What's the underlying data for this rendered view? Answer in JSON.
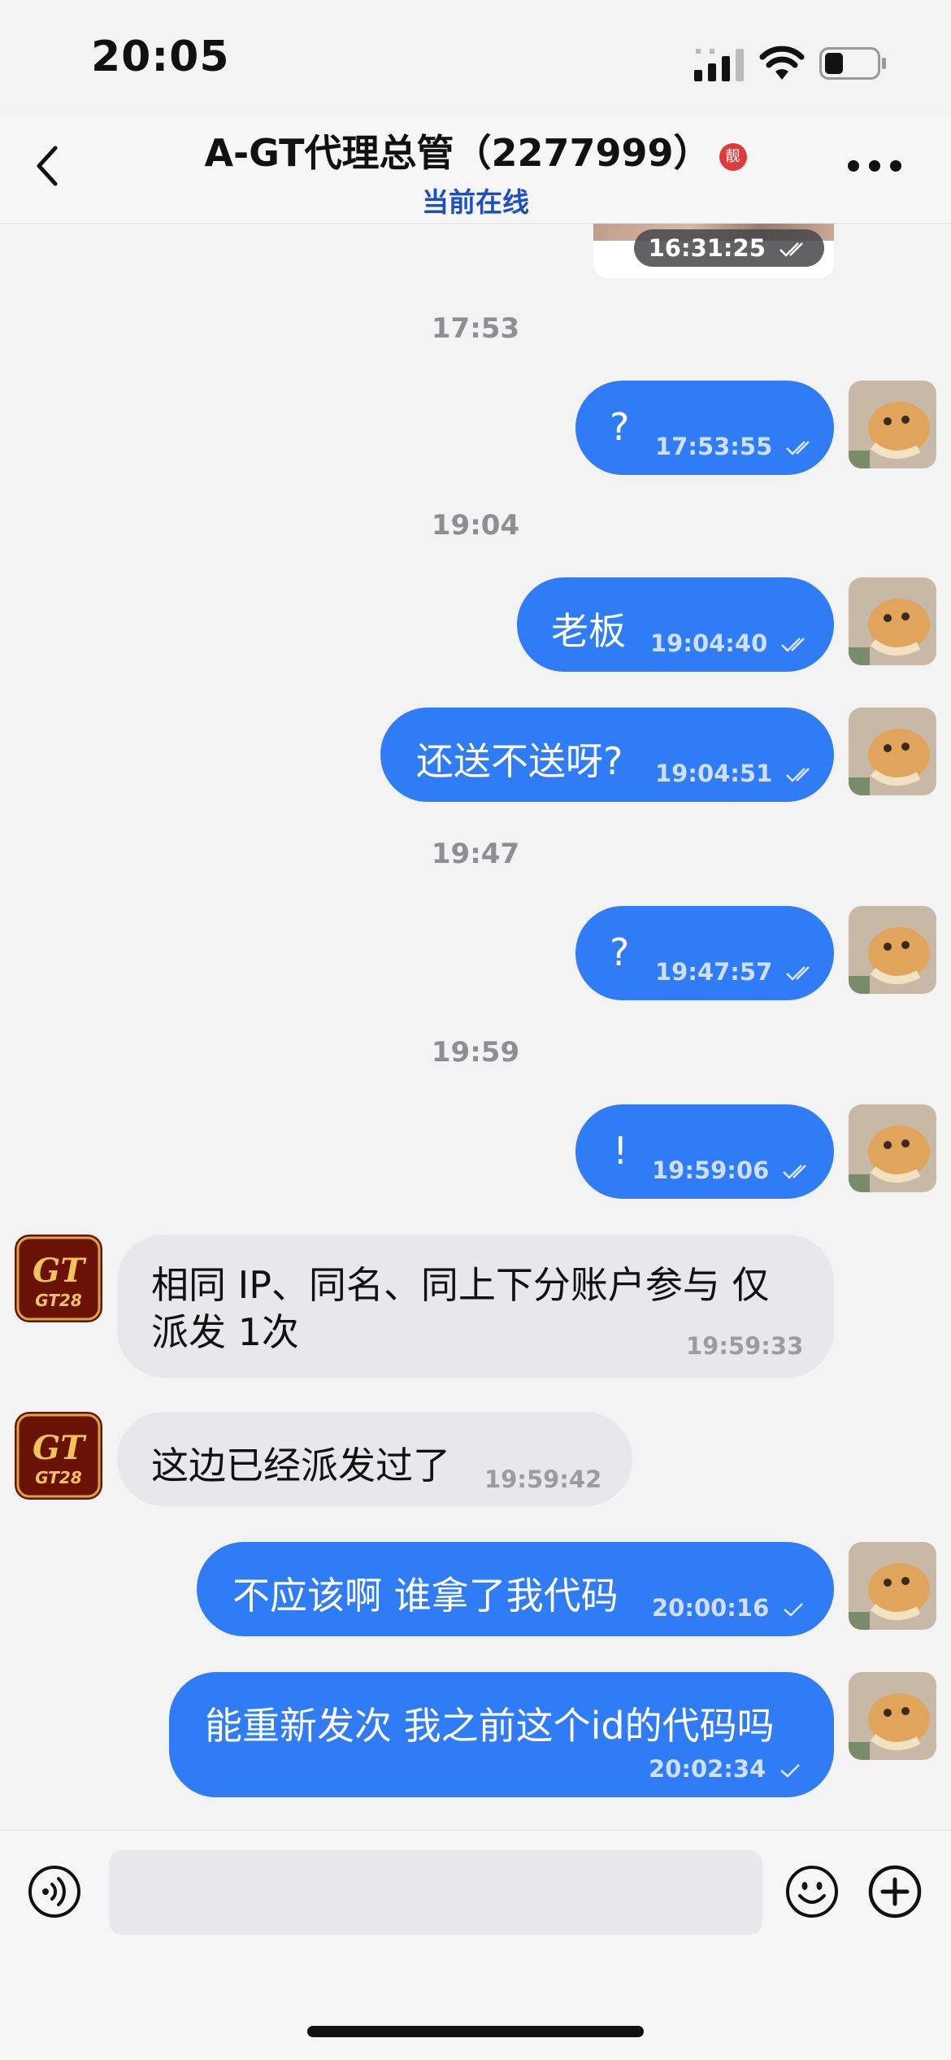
{
  "status_bar": {
    "time": "20:05"
  },
  "header": {
    "title": "A-GT代理总管（2277999）",
    "badge": "靓",
    "subtitle": "当前在线"
  },
  "chat": {
    "partial_image": {
      "time": "16:31:25"
    },
    "dividers": [
      "17:53",
      "19:04",
      "19:47",
      "19:59"
    ],
    "messages": [
      {
        "direction": "out",
        "text": "?",
        "time": "17:53:55",
        "status": "read"
      },
      {
        "direction": "out",
        "text": "老板",
        "time": "19:04:40",
        "status": "read"
      },
      {
        "direction": "out",
        "text": "还送不送呀?",
        "time": "19:04:51",
        "status": "read"
      },
      {
        "direction": "out",
        "text": "?",
        "time": "19:47:57",
        "status": "read"
      },
      {
        "direction": "out",
        "text": "!",
        "time": "19:59:06",
        "status": "read"
      },
      {
        "direction": "in",
        "text_line1": "相同 IP、同名、同上下分账户参与  仅",
        "text_line2": "派发 1次",
        "time": "19:59:33"
      },
      {
        "direction": "in",
        "text": "这边已经派发过了",
        "time": "19:59:42"
      },
      {
        "direction": "out",
        "text": "不应该啊 谁拿了我代码",
        "time": "20:00:16",
        "status": "sent"
      },
      {
        "direction": "out",
        "text": "能重新发次 我之前这个id的代码吗",
        "time": "20:02:34",
        "status": "sent"
      }
    ]
  },
  "avatars": {
    "self": "cat-photo",
    "contact_logo_text": "GT28",
    "contact_logo_mark": "GT"
  },
  "input": {
    "placeholder": ""
  },
  "colors": {
    "bubble_out": "#2f7cf6",
    "bubble_in": "#e8e8ea",
    "link_blue": "#1b4fc6",
    "background": "#f3f3f4"
  }
}
